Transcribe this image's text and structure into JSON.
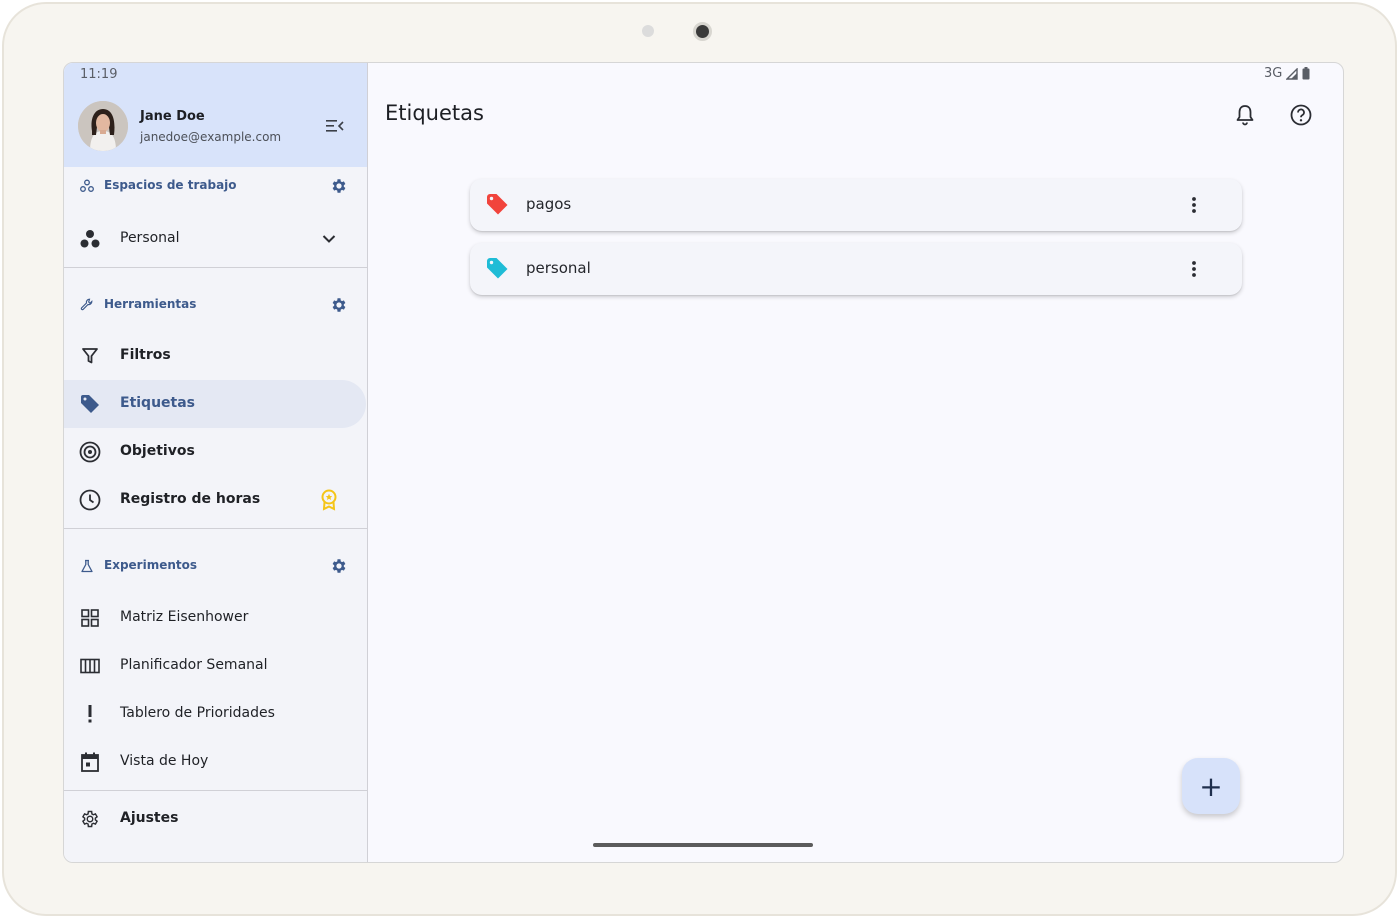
{
  "status": {
    "time": "11:19",
    "network": "3G"
  },
  "user": {
    "name": "Jane Doe",
    "email": "janedoe@example.com"
  },
  "workspaces": {
    "title": "Espacios de trabajo",
    "current": "Personal"
  },
  "tools": {
    "title": "Herramientas",
    "items": [
      {
        "label": "Filtros"
      },
      {
        "label": "Etiquetas"
      },
      {
        "label": "Objetivos"
      },
      {
        "label": "Registro de horas"
      }
    ]
  },
  "experiments": {
    "title": "Experimentos",
    "items": [
      {
        "label": "Matriz Eisenhower"
      },
      {
        "label": "Planificador Semanal"
      },
      {
        "label": "Tablero de Prioridades"
      },
      {
        "label": "Vista de Hoy"
      }
    ]
  },
  "settings": {
    "label": "Ajustes"
  },
  "main": {
    "title": "Etiquetas",
    "labels": [
      {
        "name": "pagos",
        "color": "#f1443c"
      },
      {
        "name": "personal",
        "color": "#1fbcd6"
      }
    ]
  },
  "fab": {
    "symbol": "+"
  },
  "colors": {
    "accent": "#3d5a8c",
    "drawer_header": "#d8e3fa",
    "premium_badge": "#f5c518"
  }
}
